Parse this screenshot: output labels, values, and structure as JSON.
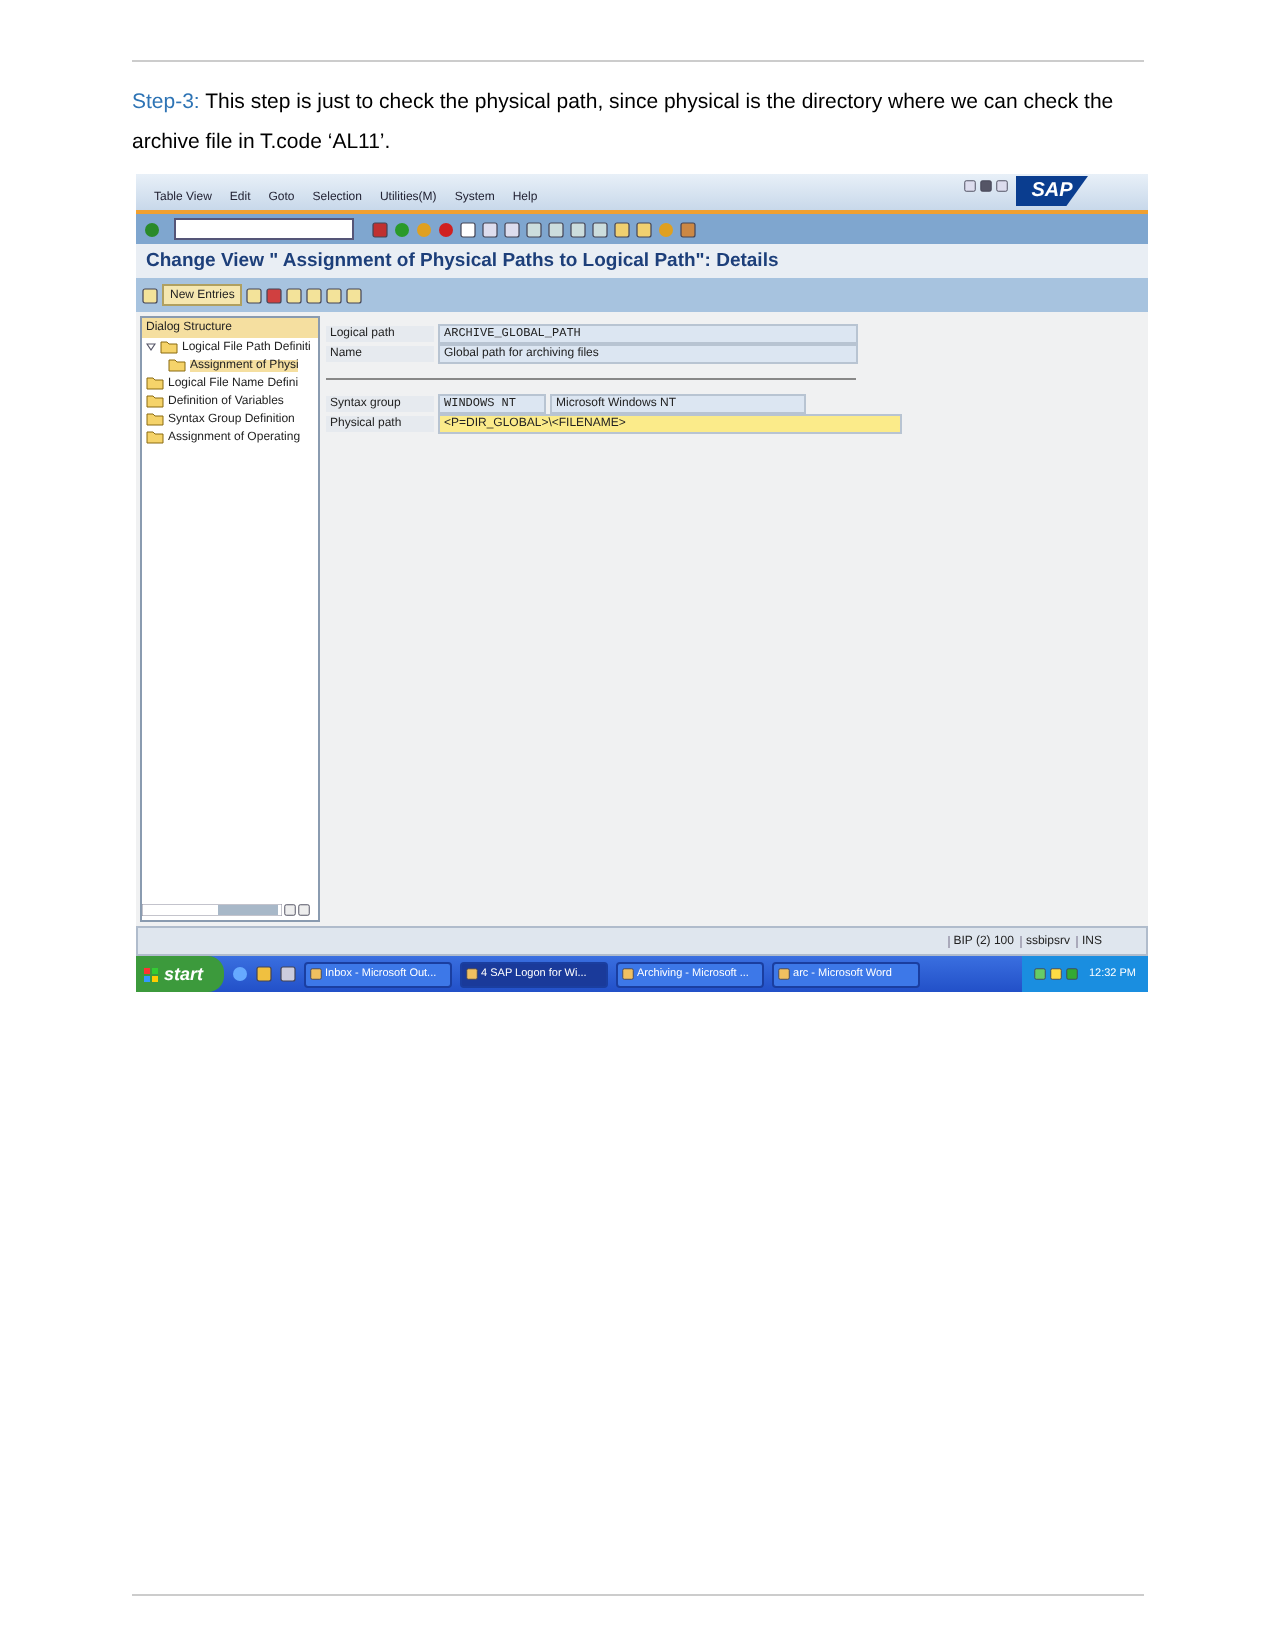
{
  "document": {
    "step_label": "Step-3:",
    "step_text": "This step is just to check the physical path, since physical is the directory where we can check the archive file in T.code ‘AL11’."
  },
  "sap": {
    "menu": [
      "Table View",
      "Edit",
      "Goto",
      "Selection",
      "Utilities(M)",
      "System",
      "Help"
    ],
    "logo": "SAP",
    "title": "Change View \" Assignment of Physical Paths to Logical Path\": Details",
    "new_entries": "New Entries",
    "tree": {
      "header": "Dialog Structure",
      "items": [
        {
          "label": "Logical File Path Definiti",
          "selected": false,
          "expanded": true,
          "children": [
            {
              "label": "Assignment of Physi",
              "selected": true
            }
          ]
        },
        {
          "label": "Logical File Name Defini",
          "selected": false
        },
        {
          "label": "Definition of Variables",
          "selected": false
        },
        {
          "label": "Syntax Group Definition",
          "selected": false
        },
        {
          "label": "Assignment of Operating",
          "selected": false
        }
      ]
    },
    "fields": [
      {
        "label": "Logical path",
        "value": "ARCHIVE_GLOBAL_PATH",
        "editable": false
      },
      {
        "label": "Name",
        "value": "Global path for archiving files",
        "editable": false
      },
      {
        "label": "Syntax group",
        "value": "WINDOWS NT",
        "description": "Microsoft Windows NT",
        "editable": false
      },
      {
        "label": "Physical path",
        "value": "<P=DIR_GLOBAL>\\<FILENAME>",
        "editable": true
      }
    ],
    "status_bar": [
      "BIP (2) 100",
      "ssbipsrv",
      "INS"
    ]
  },
  "taskbar": {
    "start": "start",
    "tasks": [
      {
        "label": "Inbox - Microsoft Out...",
        "selected": false
      },
      {
        "label": "4 SAP Logon for Wi...",
        "selected": true
      },
      {
        "label": "Archiving - Microsoft ...",
        "selected": false
      },
      {
        "label": "arc - Microsoft Word",
        "selected": false
      }
    ],
    "clock": "12:32 PM"
  }
}
